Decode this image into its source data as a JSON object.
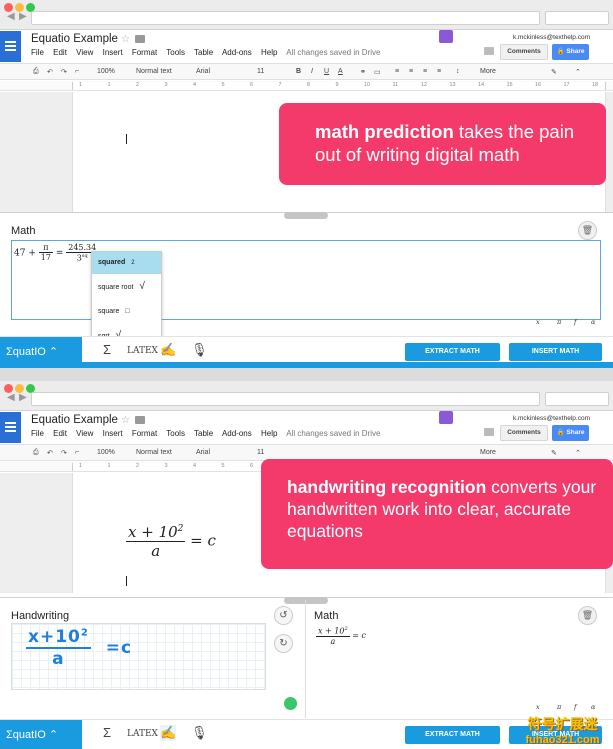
{
  "browser": {
    "colors": {
      "close": "#fc605b",
      "minimize": "#fdbc40",
      "zoom": "#34c84a"
    }
  },
  "docs": {
    "title": "Equatio Example",
    "menu": [
      "File",
      "Edit",
      "View",
      "Insert",
      "Format",
      "Tools",
      "Table",
      "Add-ons",
      "Help"
    ],
    "saved_status": "All changes saved in Drive",
    "account": "k.mckinless@texthelp.com",
    "comments_label": "Comments",
    "share_label": "Share",
    "toolbar": {
      "zoom": "100%",
      "style": "Normal text",
      "font": "Arial",
      "size": "11",
      "more": "More"
    },
    "ruler_ticks": [
      "1",
      "1",
      "2",
      "3",
      "4",
      "5",
      "6",
      "7",
      "8",
      "9",
      "10",
      "11",
      "12",
      "13",
      "14",
      "15",
      "16",
      "17",
      "18"
    ]
  },
  "screen1": {
    "banner": {
      "bold": "math prediction",
      "rest": " takes the pain out of writing digital math"
    },
    "panel_title": "Math",
    "expression": {
      "lhs": "47",
      "plus": "+",
      "frac_num": "π",
      "frac_den": "17",
      "equals": "=",
      "rhs_num": "245.34",
      "rhs_den": "3",
      "rhs_den_sup": "sq"
    },
    "suggestions": [
      {
        "label": "squared",
        "preview": "2",
        "selected": true
      },
      {
        "label": "square root",
        "preview": "√"
      },
      {
        "label": "square",
        "preview": "□"
      },
      {
        "label": "sqrt",
        "preview": "√"
      }
    ]
  },
  "screen2": {
    "banner": {
      "bold": "handwriting recognition",
      "rest": " converts your handwritten work into clear, accurate equations"
    },
    "doc_equation": {
      "num": "x + 10",
      "num_sup": "2",
      "den": "a",
      "rhs": "= c"
    },
    "handwriting_title": "Handwriting",
    "handwriting_strokes": {
      "num": "x+10",
      "num_sup": "2",
      "den": "a",
      "rhs": "=c"
    },
    "math_title": "Math",
    "math_result": {
      "num": "x + 10",
      "num_sup": "2",
      "den": "a",
      "rhs": "= c"
    }
  },
  "equatio_bar": {
    "logo": "ΣquatIO",
    "latex": "LATEX",
    "extract": "EXTRACT MATH",
    "insert": "INSERT MATH",
    "symbols": [
      "x",
      "π",
      "f",
      "α"
    ]
  },
  "watermark": {
    "line1": "符号扩展迷",
    "line2": "fuhao321.com"
  }
}
